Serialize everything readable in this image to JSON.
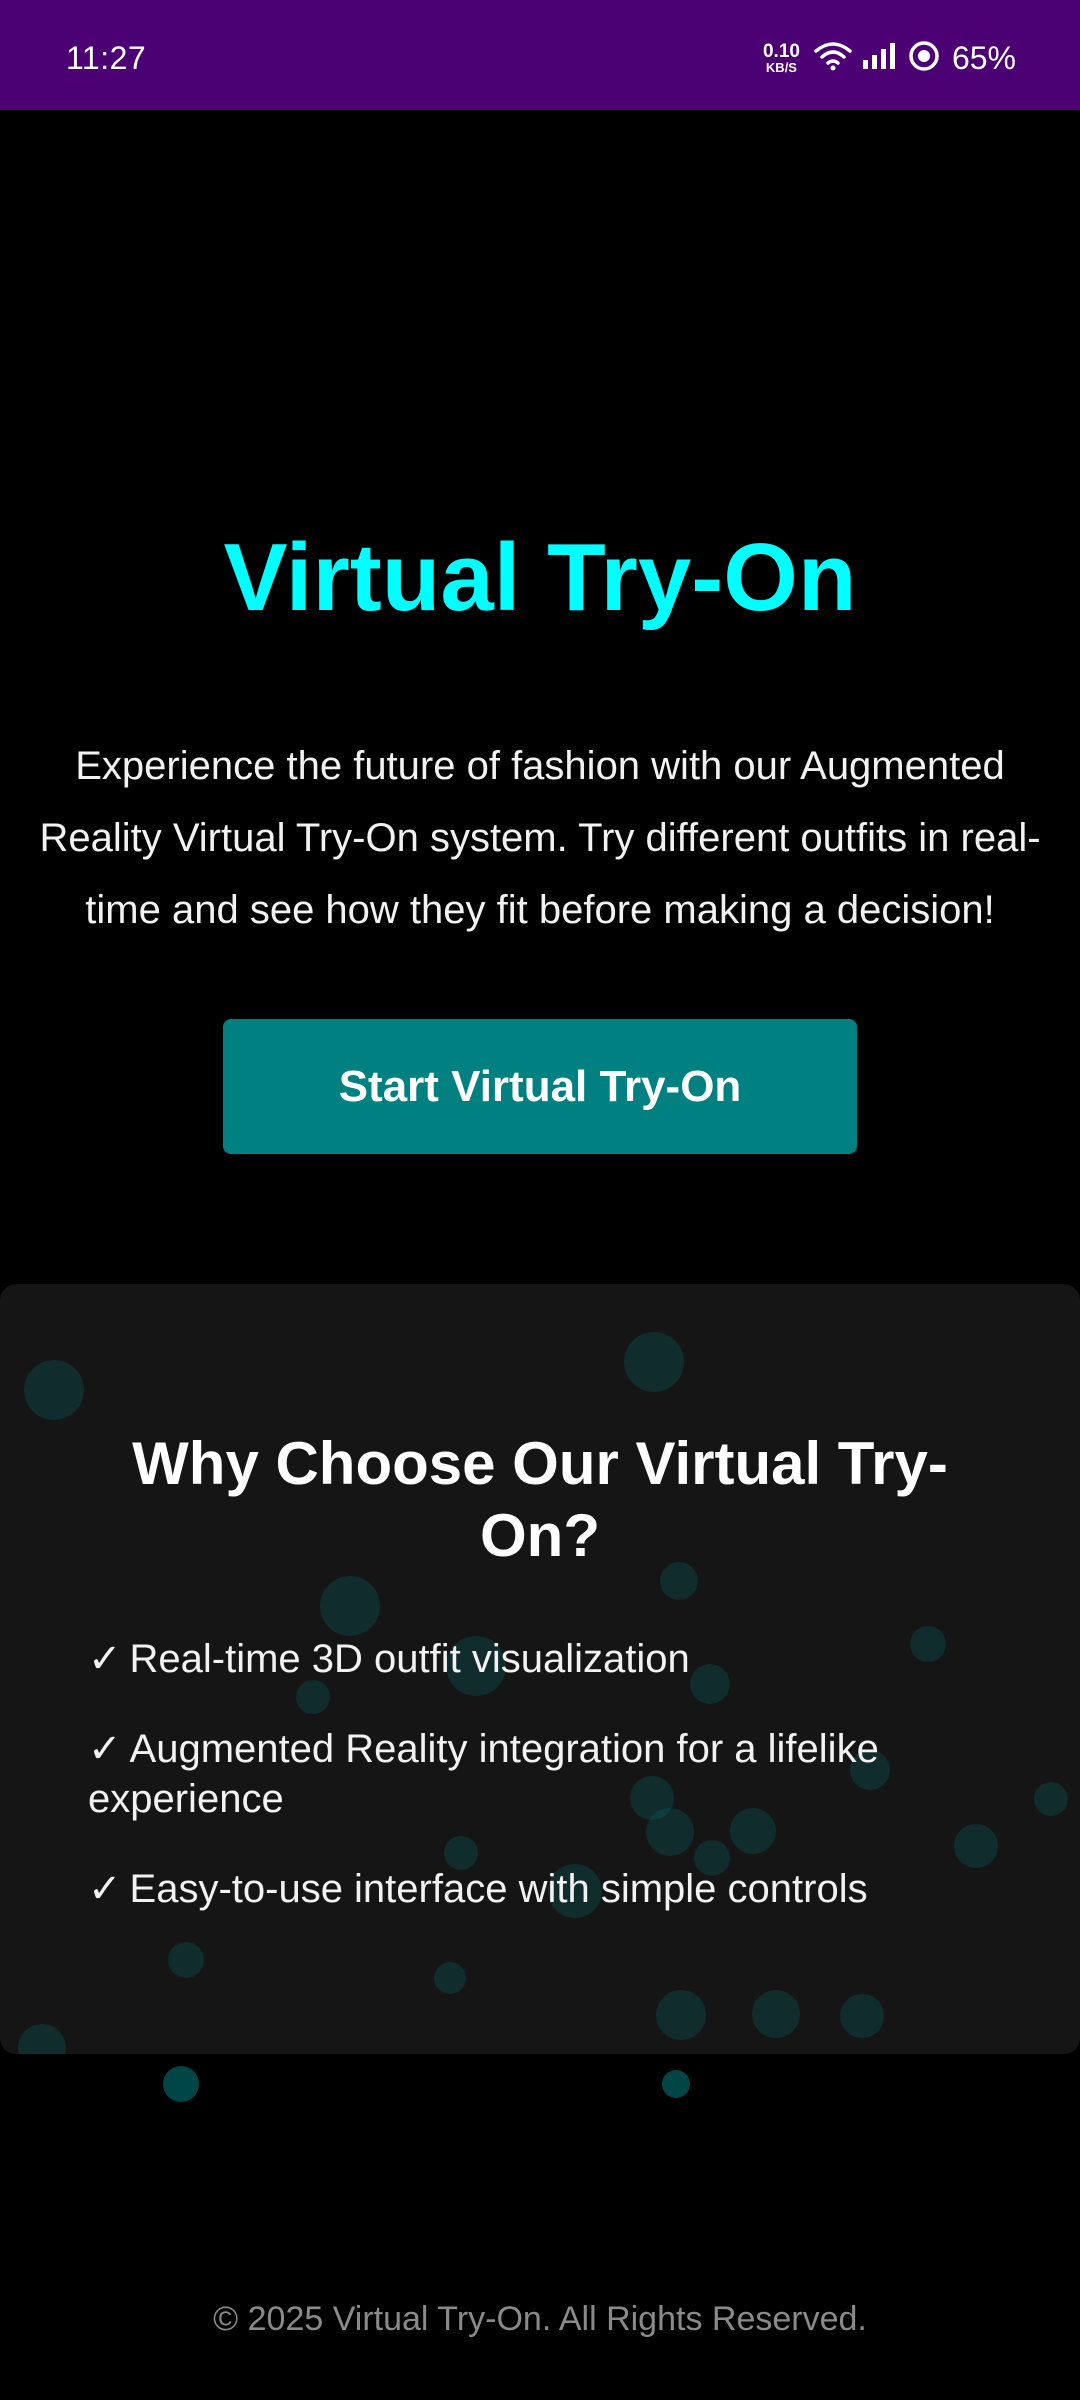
{
  "status_bar": {
    "time": "11:27",
    "net_speed_value": "0.10",
    "net_speed_unit": "KB/S",
    "battery": "65%",
    "icons": [
      "wifi-icon",
      "signal-icon",
      "battery-ring-icon"
    ]
  },
  "hero": {
    "title": "Virtual Try-On",
    "description": "Experience the future of fashion with our Augmented Reality Virtual Try-On system. Try different outfits in real-time and see how they fit before making a decision!",
    "cta_label": "Start Virtual Try-On"
  },
  "features": {
    "title": "Why Choose Our Virtual Try-On?",
    "check_symbol": "✓",
    "items": [
      "Real-time 3D outfit visualization",
      "Augmented Reality integration for a lifelike experience",
      "Easy-to-use interface with simple controls"
    ]
  },
  "footer": {
    "text": "© 2025 Virtual Try-On. All Rights Reserved."
  },
  "colors": {
    "status_bar_bg": "#4b0073",
    "title": "#00ffff",
    "button_bg": "#008080",
    "card_bg": "#151515",
    "page_bg": "#000000"
  }
}
